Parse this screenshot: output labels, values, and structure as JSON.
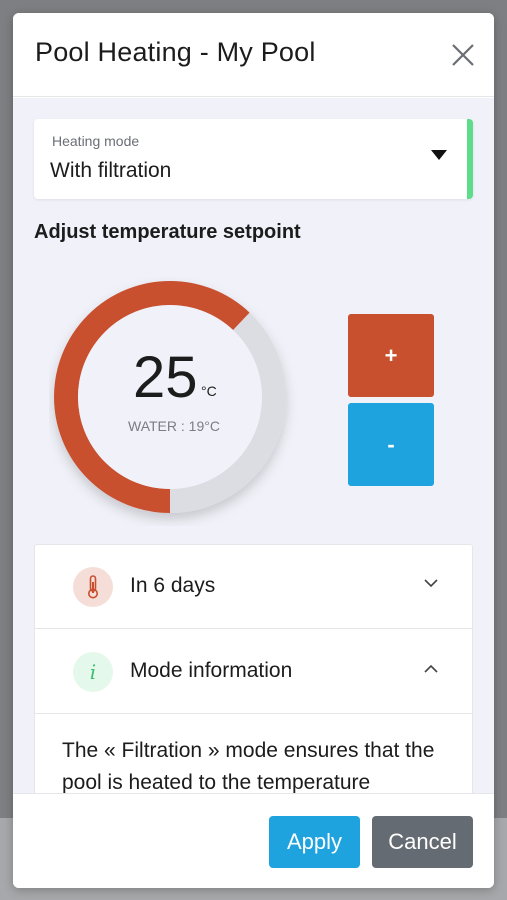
{
  "dialog": {
    "title": "Pool Heating - My Pool",
    "close_icon": "close-icon"
  },
  "heating_mode": {
    "label": "Heating mode",
    "value": "With filtration",
    "accent_color": "#5ddc8a"
  },
  "setpoint": {
    "section_title": "Adjust temperature setpoint",
    "temperature": "25",
    "unit": "°C",
    "water_text": "WATER : 19°C",
    "ring_fill_fraction": 0.62,
    "ring_color": "#c9502f",
    "plus_label": "+",
    "minus_label": "-",
    "plus_color": "#c9502f",
    "minus_color": "#1ea3de"
  },
  "accordion": {
    "items": [
      {
        "label": "In 6 days",
        "icon": "thermometer-icon",
        "chevron": "chevron-down-icon"
      },
      {
        "label": "Mode information",
        "icon": "info-icon",
        "icon_text": "i",
        "chevron": "chevron-up-icon"
      }
    ],
    "content": "The « Filtration » mode ensures that the pool is heated to the temperature"
  },
  "footer": {
    "apply_label": "Apply",
    "cancel_label": "Cancel"
  }
}
